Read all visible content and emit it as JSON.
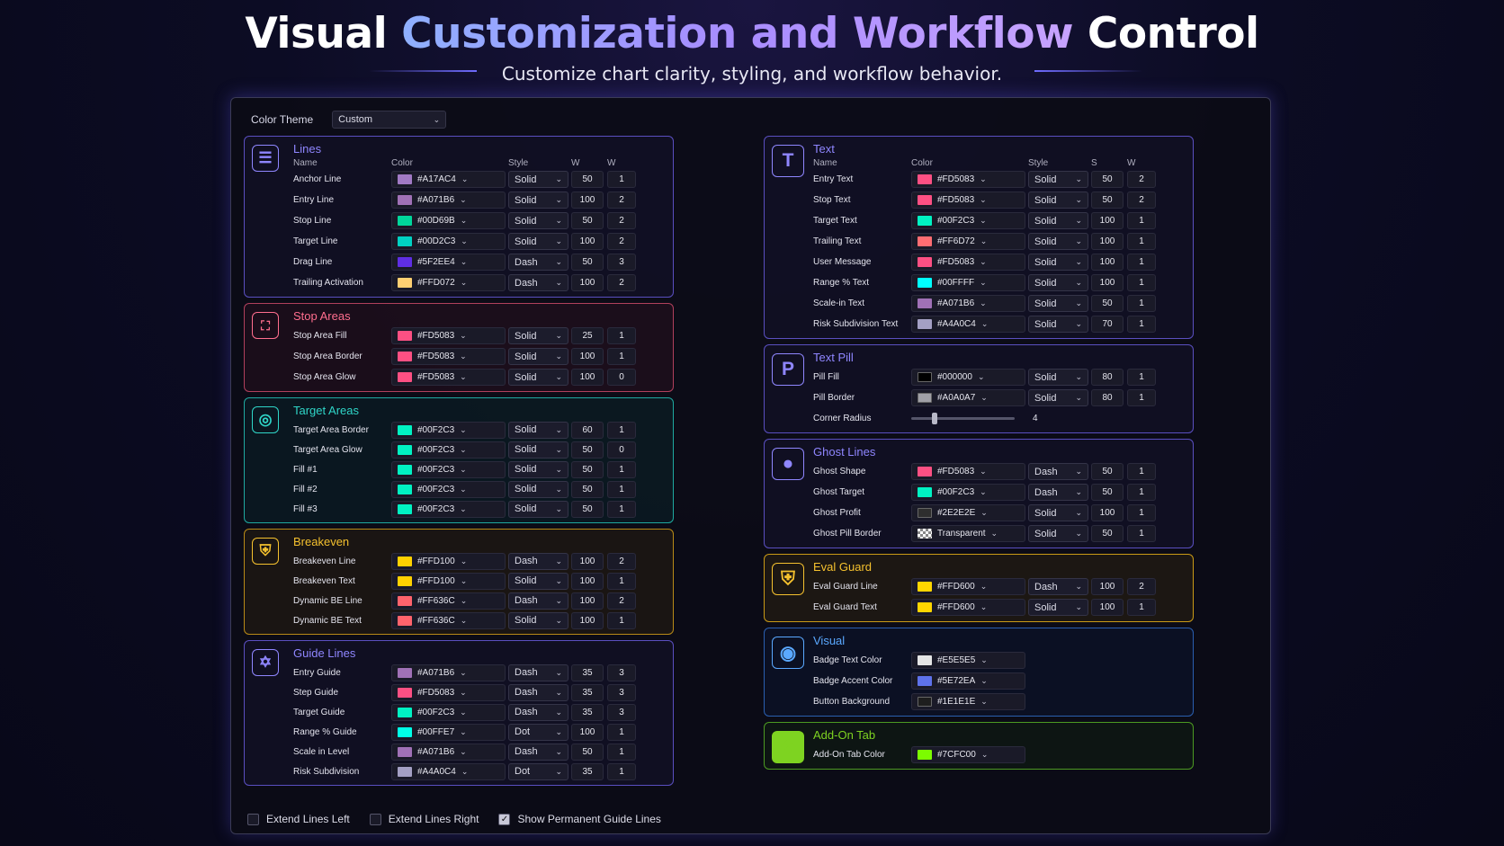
{
  "hero": {
    "title_start": "Visual ",
    "title_highlight": "Customization and Workflow",
    "title_end": " Control",
    "subtitle": "Customize chart clarity, styling, and workflow behavior."
  },
  "theme": {
    "label": "Color Theme",
    "value": "Custom"
  },
  "columns_left": {
    "name": "Name",
    "color": "Color",
    "style": "Style",
    "w1": "W",
    "w2": "W"
  },
  "columns_right": {
    "name": "Name",
    "color": "Color",
    "style": "Style",
    "w1": "S",
    "w2": "W"
  },
  "lines": {
    "title": "Lines",
    "color": "#8f86ff",
    "rows": [
      {
        "name": "Anchor Line",
        "hex": "#A17AC4",
        "style": "Solid",
        "w1": "50",
        "w2": "1"
      },
      {
        "name": "Entry Line",
        "hex": "#A071B6",
        "style": "Solid",
        "w1": "100",
        "w2": "2"
      },
      {
        "name": "Stop Line",
        "hex": "#00D69B",
        "style": "Solid",
        "w1": "50",
        "w2": "2"
      },
      {
        "name": "Target Line",
        "hex": "#00D2C3",
        "style": "Solid",
        "w1": "100",
        "w2": "2"
      },
      {
        "name": "Drag Line",
        "hex": "#5F2EE4",
        "style": "Dash",
        "w1": "50",
        "w2": "3"
      },
      {
        "name": "Trailing Activation",
        "hex": "#FFD072",
        "style": "Dash",
        "w1": "100",
        "w2": "2"
      }
    ]
  },
  "stop_areas": {
    "title": "Stop Areas",
    "color": "#ff6e8e",
    "rows": [
      {
        "name": "Stop Area Fill",
        "hex": "#FD5083",
        "style": "Solid",
        "w1": "25",
        "w2": "1"
      },
      {
        "name": "Stop Area Border",
        "hex": "#FD5083",
        "style": "Solid",
        "w1": "100",
        "w2": "1"
      },
      {
        "name": "Stop Area Glow",
        "hex": "#FD5083",
        "style": "Solid",
        "w1": "100",
        "w2": "0"
      }
    ]
  },
  "target_areas": {
    "title": "Target Areas",
    "color": "#2fd6c8",
    "rows": [
      {
        "name": "Target Area Border",
        "hex": "#00F2C3",
        "style": "Solid",
        "w1": "60",
        "w2": "1"
      },
      {
        "name": "Target Area Glow",
        "hex": "#00F2C3",
        "style": "Solid",
        "w1": "50",
        "w2": "0"
      },
      {
        "name": "Fill #1",
        "hex": "#00F2C3",
        "style": "Solid",
        "w1": "50",
        "w2": "1"
      },
      {
        "name": "Fill #2",
        "hex": "#00F2C3",
        "style": "Solid",
        "w1": "50",
        "w2": "1"
      },
      {
        "name": "Fill #3",
        "hex": "#00F2C3",
        "style": "Solid",
        "w1": "50",
        "w2": "1"
      }
    ]
  },
  "breakeven": {
    "title": "Breakeven",
    "color": "#f5c12e",
    "rows": [
      {
        "name": "Breakeven Line",
        "hex": "#FFD100",
        "style": "Dash",
        "w1": "100",
        "w2": "2"
      },
      {
        "name": "Breakeven Text",
        "hex": "#FFD100",
        "style": "Solid",
        "w1": "100",
        "w2": "1"
      },
      {
        "name": "Dynamic BE Line",
        "hex": "#FF636C",
        "style": "Dash",
        "w1": "100",
        "w2": "2"
      },
      {
        "name": "Dynamic BE Text",
        "hex": "#FF636C",
        "style": "Solid",
        "w1": "100",
        "w2": "1"
      }
    ]
  },
  "guide_lines": {
    "title": "Guide Lines",
    "color": "#8f86ff",
    "rows": [
      {
        "name": "Entry Guide",
        "hex": "#A071B6",
        "style": "Dash",
        "w1": "35",
        "w2": "3"
      },
      {
        "name": "Step Guide",
        "hex": "#FD5083",
        "style": "Dash",
        "w1": "35",
        "w2": "3"
      },
      {
        "name": "Target Guide",
        "hex": "#00F2C3",
        "style": "Dash",
        "w1": "35",
        "w2": "3"
      },
      {
        "name": "Range % Guide",
        "hex": "#00FFE7",
        "style": "Dot",
        "w1": "100",
        "w2": "1"
      },
      {
        "name": "Scale in Level",
        "hex": "#A071B6",
        "style": "Dash",
        "w1": "50",
        "w2": "1"
      },
      {
        "name": "Risk Subdivision",
        "hex": "#A4A0C4",
        "style": "Dot",
        "w1": "35",
        "w2": "1"
      }
    ]
  },
  "text": {
    "title": "Text",
    "color": "#8f86ff",
    "rows": [
      {
        "name": "Entry Text",
        "hex": "#FD5083",
        "style": "Solid",
        "w1": "50",
        "w2": "2"
      },
      {
        "name": "Stop Text",
        "hex": "#FD5083",
        "style": "Solid",
        "w1": "50",
        "w2": "2"
      },
      {
        "name": "Target Text",
        "hex": "#00F2C3",
        "style": "Solid",
        "w1": "100",
        "w2": "1"
      },
      {
        "name": "Trailing Text",
        "hex": "#FF6D72",
        "style": "Solid",
        "w1": "100",
        "w2": "1"
      },
      {
        "name": "User Message",
        "hex": "#FD5083",
        "style": "Solid",
        "w1": "100",
        "w2": "1"
      },
      {
        "name": "Range % Text",
        "hex": "#00FFFF",
        "style": "Solid",
        "w1": "100",
        "w2": "1"
      },
      {
        "name": "Scale-in Text",
        "hex": "#A071B6",
        "style": "Solid",
        "w1": "50",
        "w2": "1"
      },
      {
        "name": "Risk Subdivision Text",
        "hex": "#A4A0C4",
        "style": "Solid",
        "w1": "70",
        "w2": "1"
      }
    ]
  },
  "text_pill": {
    "title": "Text Pill",
    "color": "#8f86ff",
    "rows": [
      {
        "name": "Pill Fill",
        "hex": "#000000",
        "style": "Solid",
        "w1": "80",
        "w2": "1"
      },
      {
        "name": "Pill Border",
        "hex": "#A0A0A7",
        "style": "Solid",
        "w1": "80",
        "w2": "1"
      }
    ],
    "corner_label": "Corner Radius",
    "corner_value": "4",
    "corner_fraction": 0.23
  },
  "ghost_lines": {
    "title": "Ghost Lines",
    "color": "#8f86ff",
    "rows": [
      {
        "name": "Ghost Shape",
        "hex": "#FD5083",
        "style": "Dash",
        "w1": "50",
        "w2": "1"
      },
      {
        "name": "Ghost Target",
        "hex": "#00F2C3",
        "style": "Dash",
        "w1": "50",
        "w2": "1"
      },
      {
        "name": "Ghost Profit",
        "hex": "#2E2E2E",
        "style": "Solid",
        "w1": "100",
        "w2": "1"
      },
      {
        "name": "Ghost Pill Border",
        "hex": "Transparent",
        "style": "Solid",
        "w1": "50",
        "w2": "1"
      }
    ]
  },
  "eval_guard": {
    "title": "Eval Guard",
    "color": "#f5c12e",
    "rows": [
      {
        "name": "Eval Guard Line",
        "hex": "#FFD600",
        "style": "Dash",
        "w1": "100",
        "w2": "2"
      },
      {
        "name": "Eval Guard Text",
        "hex": "#FFD600",
        "style": "Solid",
        "w1": "100",
        "w2": "1"
      }
    ]
  },
  "visual": {
    "title": "Visual",
    "color": "#5aa8ff",
    "rows": [
      {
        "name": "Badge Text Color",
        "hex": "#E5E5E5"
      },
      {
        "name": "Badge Accent Color",
        "hex": "#5E72EA"
      },
      {
        "name": "Button Background",
        "hex": "#1E1E1E"
      }
    ]
  },
  "addon": {
    "title": "Add-On Tab",
    "color": "#7ed321",
    "rows": [
      {
        "name": "Add-On Tab Color",
        "hex": "#7CFC00"
      }
    ]
  },
  "options": {
    "extend_left": {
      "label": "Extend Lines Left",
      "checked": false
    },
    "extend_right": {
      "label": "Extend Lines Right",
      "checked": false
    },
    "guide_lines": {
      "label": "Show Permanent Guide Lines",
      "checked": true
    }
  }
}
